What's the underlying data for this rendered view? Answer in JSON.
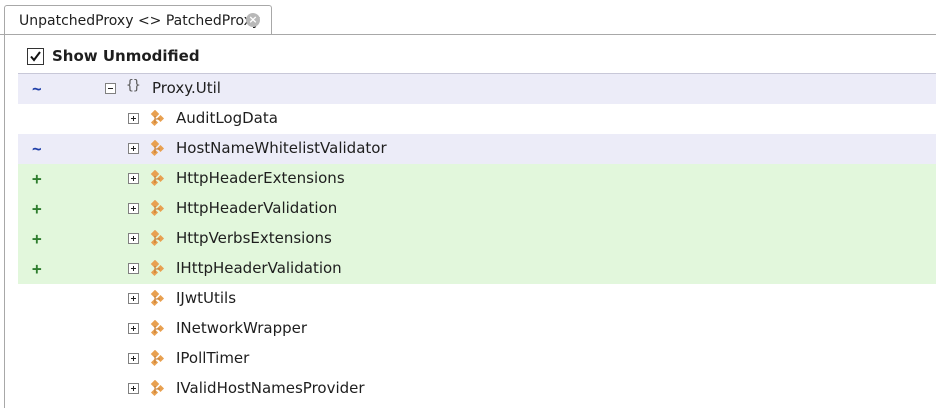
{
  "tab": {
    "title": "UnpatchedProxy <> PatchedProxy"
  },
  "toolbar": {
    "show_unmodified_label": "Show Unmodified",
    "show_unmodified_checked": true
  },
  "tree": {
    "namespace": {
      "marker": "~",
      "name": "Proxy.Util",
      "status": "modified",
      "icon": "namespace-braces-icon"
    },
    "types": [
      {
        "marker": "",
        "name": "AuditLogData",
        "status": "unchanged"
      },
      {
        "marker": "~",
        "name": "HostNameWhitelistValidator",
        "status": "modified"
      },
      {
        "marker": "+",
        "name": "HttpHeaderExtensions",
        "status": "added"
      },
      {
        "marker": "+",
        "name": "HttpHeaderValidation",
        "status": "added"
      },
      {
        "marker": "+",
        "name": "HttpVerbsExtensions",
        "status": "added"
      },
      {
        "marker": "+",
        "name": "IHttpHeaderValidation",
        "status": "added"
      },
      {
        "marker": "",
        "name": "IJwtUtils",
        "status": "unchanged"
      },
      {
        "marker": "",
        "name": "INetworkWrapper",
        "status": "unchanged"
      },
      {
        "marker": "",
        "name": "IPollTimer",
        "status": "unchanged"
      },
      {
        "marker": "",
        "name": "IValidHostNamesProvider",
        "status": "unchanged"
      }
    ]
  },
  "colors": {
    "modified_row": "#ececf8",
    "added_row": "#e2f7dc",
    "modified_marker": "#1f3fa8",
    "added_marker": "#2f7d2f",
    "class_icon": "#e8a050"
  }
}
